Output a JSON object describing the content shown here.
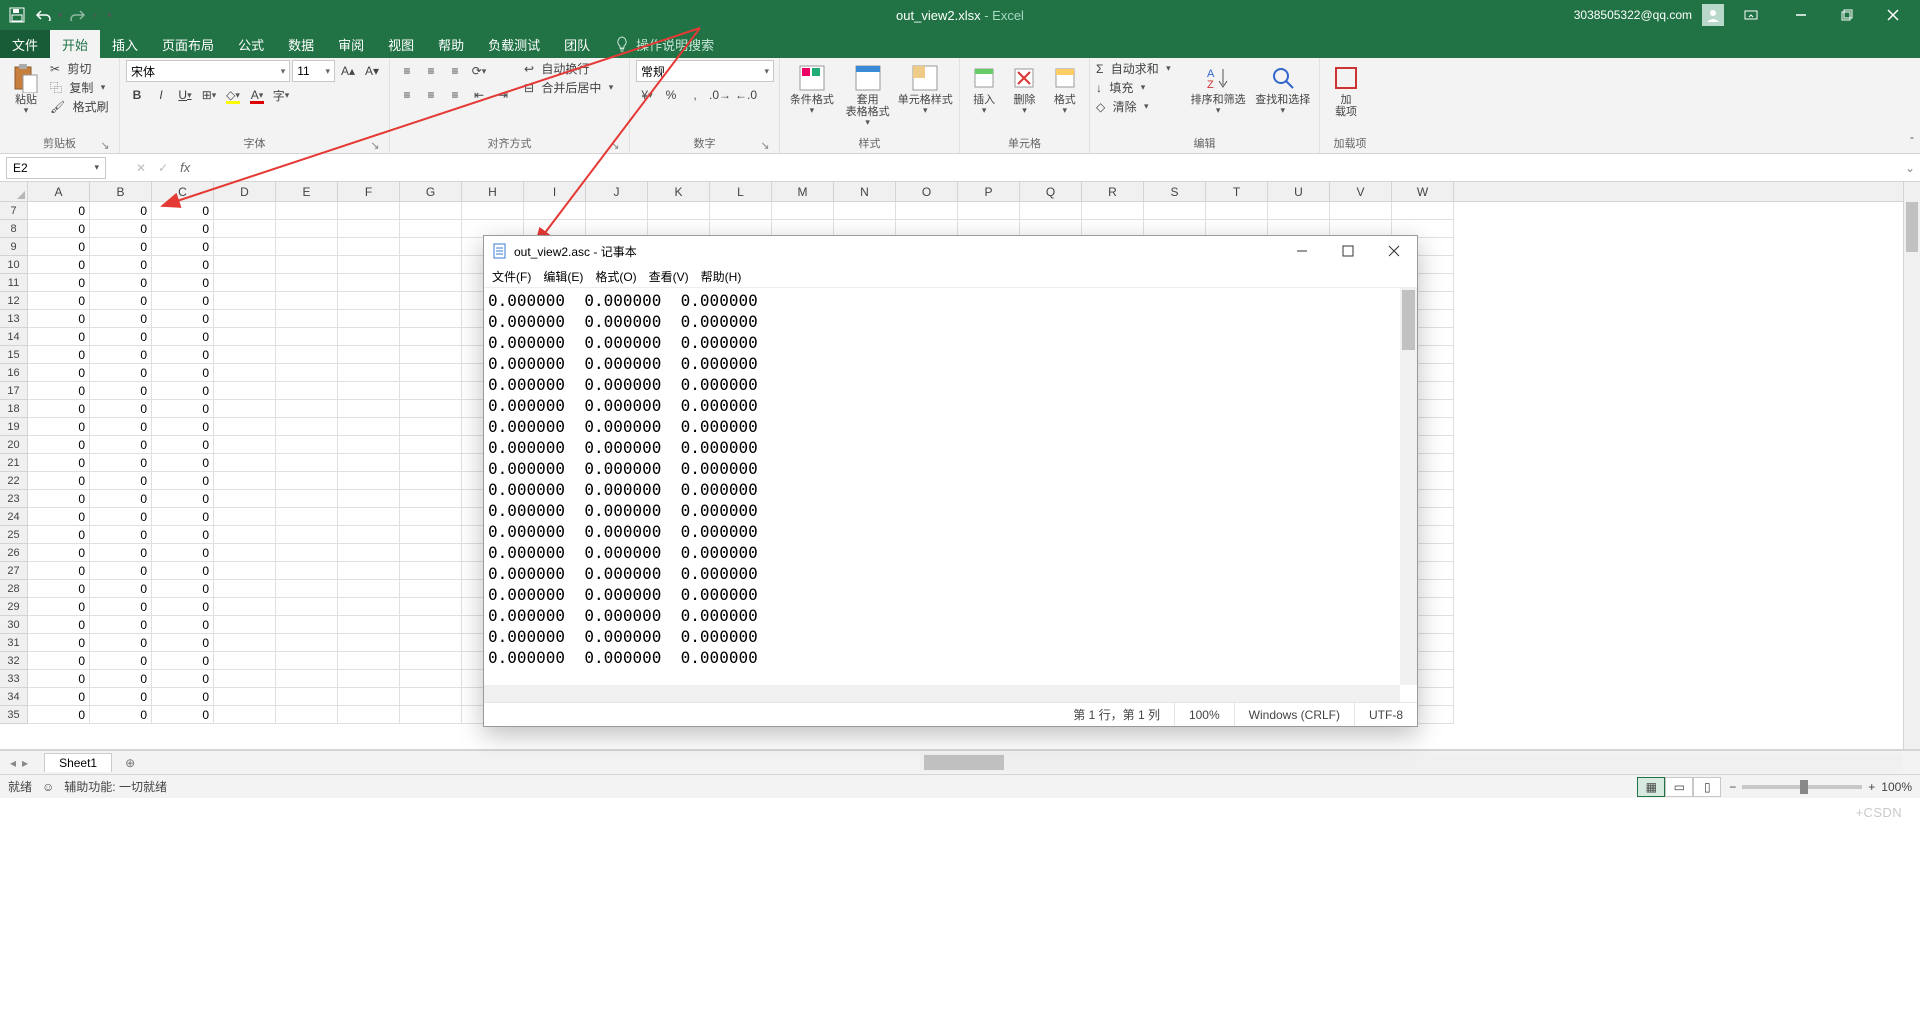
{
  "app": {
    "filename": "out_view2.xlsx",
    "appname": "Excel",
    "separator": "  -  ",
    "account": "3038505322@qq.com"
  },
  "qat": {
    "save": "💾",
    "undo": "↶",
    "redo": "↷"
  },
  "tabs": {
    "file": "文件",
    "home": "开始",
    "insert": "插入",
    "layout": "页面布局",
    "formulas": "公式",
    "data": "数据",
    "review": "审阅",
    "view": "视图",
    "help": "帮助",
    "loadtest": "负载测试",
    "team": "团队",
    "tellme": "操作说明搜索"
  },
  "ribbon": {
    "clipboard": {
      "label": "剪贴板",
      "paste": "粘贴",
      "cut": "剪切",
      "copy": "复制",
      "painter": "格式刷"
    },
    "font": {
      "label": "字体",
      "name": "宋体",
      "size": "11",
      "bold": "B",
      "italic": "I",
      "underline": "U"
    },
    "align": {
      "label": "对齐方式",
      "wrap": "自动换行",
      "merge": "合并后居中"
    },
    "number": {
      "label": "数字",
      "format": "常规"
    },
    "styles": {
      "label": "样式",
      "cond": "条件格式",
      "tablestyle": "套用\n表格格式",
      "cellstyle": "单元格样式"
    },
    "cells": {
      "label": "单元格",
      "insert": "插入",
      "delete": "删除",
      "format": "格式"
    },
    "editing": {
      "label": "编辑",
      "autosum": "自动求和",
      "fill": "填充",
      "clear": "清除",
      "sort": "排序和筛选",
      "find": "查找和选择"
    },
    "addins": {
      "label": "加载项",
      "addin": "加\n载项"
    }
  },
  "formulabar": {
    "name": "E2"
  },
  "grid": {
    "cols": [
      "A",
      "B",
      "C",
      "D",
      "E",
      "F",
      "G",
      "H",
      "I",
      "J",
      "K",
      "L",
      "M",
      "N",
      "O",
      "P",
      "Q",
      "R",
      "S",
      "T",
      "U",
      "V",
      "W"
    ],
    "firstRow": 7,
    "lastRow": 35,
    "dataCols": 3,
    "cellValue": "0"
  },
  "sheetbar": {
    "sheet1": "Sheet1"
  },
  "statusbar": {
    "ready": "就绪",
    "access": "辅助功能: 一切就绪",
    "zoom": "100%"
  },
  "notepad": {
    "title": "out_view2.asc - 记事本",
    "menu": {
      "file": "文件(F)",
      "edit": "编辑(E)",
      "format": "格式(O)",
      "view": "查看(V)",
      "help": "帮助(H)"
    },
    "line": "0.000000  0.000000  0.000000",
    "lines": 18,
    "status": {
      "pos": "第 1 行，第 1 列",
      "zoom": "100%",
      "eol": "Windows (CRLF)",
      "enc": "UTF-8"
    }
  },
  "watermark": "+CSDN"
}
